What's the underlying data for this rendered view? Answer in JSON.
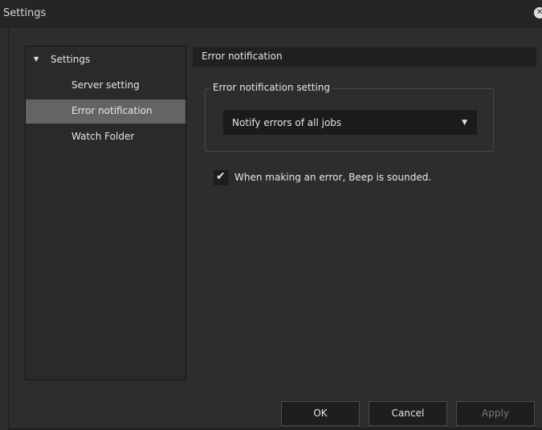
{
  "window": {
    "title": "Settings",
    "close_icon": "close-icon"
  },
  "tree": {
    "root_label": "Settings",
    "root_expanded": true,
    "items": [
      {
        "label": "Server setting",
        "selected": false
      },
      {
        "label": "Error notification",
        "selected": true
      },
      {
        "label": "Watch Folder",
        "selected": false
      }
    ]
  },
  "content": {
    "header": "Error notification",
    "group_title": "Error notification setting",
    "dropdown_value": "Notify errors of all jobs",
    "checkbox_label": "When making an error, Beep is sounded.",
    "checkbox_checked": true
  },
  "buttons": {
    "ok": "OK",
    "cancel": "Cancel",
    "apply": "Apply",
    "apply_enabled": false
  }
}
